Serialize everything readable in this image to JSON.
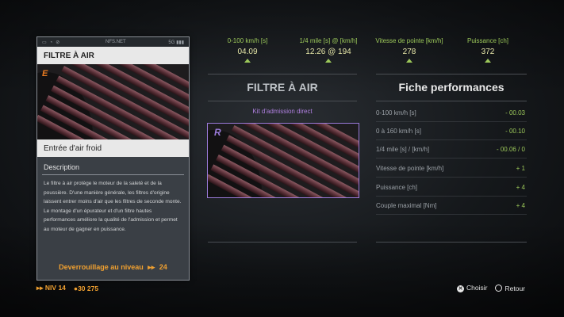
{
  "card": {
    "phone_status": "NFS.NET",
    "phone_signal": "5G",
    "title": "FILTRE À AIR",
    "subtitle": "Entrée d'air froid",
    "description_heading": "Description",
    "description_text": "Le filtre à air protège le moteur de la saleté et de la poussière. D'une manière générale, les filtres d'origine laissent entrer moins d'air que les filtres de seconde monte. Le montage d'un épurateur et d'un filtre hautes performances améliore la qualité de l'admission et permet au moteur de gagner en puissance.",
    "unlock_label": "Deverrouillage au niveau",
    "unlock_level": "24",
    "badge_letter": "E"
  },
  "stats": [
    {
      "label": "0-100 km/h [s]",
      "value": "04.09"
    },
    {
      "label": "1/4 mile [s] @ [km/h]",
      "value": "12.26 @ 194"
    },
    {
      "label": "Vitesse de pointe [km/h]",
      "value": "278"
    },
    {
      "label": "Puissance [ch]",
      "value": "372"
    }
  ],
  "middle": {
    "title": "FILTRE À AIR",
    "subtitle": "Kit d'admission direct",
    "badge_letter": "R"
  },
  "performance": {
    "title": "Fiche performances",
    "rows": [
      {
        "label": "0-100 km/h [s]",
        "delta": "- 00.03"
      },
      {
        "label": "0 à 160 km/h [s]",
        "delta": "- 00.10"
      },
      {
        "label": "1/4 mile [s] / [km/h]",
        "delta": "- 00.06 / 0"
      },
      {
        "label": "Vitesse de pointe [km/h]",
        "delta": "+ 1"
      },
      {
        "label": "Puissance [ch]",
        "delta": "+ 4"
      },
      {
        "label": "Couple maximal [Nm]",
        "delta": "+ 4"
      }
    ]
  },
  "bottom": {
    "level_label": "NIV 14",
    "currency": "30 275",
    "choose_label": "Choisir",
    "back_label": "Retour"
  },
  "colors": {
    "accent_orange": "#f0a030",
    "accent_green": "#9cc85a",
    "accent_purple": "#9a7ad8"
  }
}
